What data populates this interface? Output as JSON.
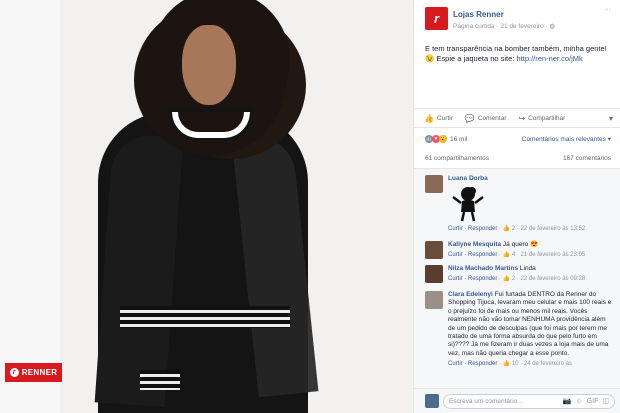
{
  "photo": {
    "brand_badge": "RENNER",
    "brand_mark": "r"
  },
  "post": {
    "page_name": "Lojas Renner",
    "page_avatar_letter": "r",
    "meta_source": "Página curtida",
    "meta_date": "21 de fevereiro",
    "meta_globe": "◍",
    "more_icon": "···",
    "text_line": "E tem transparência na bomber também, minha gente! 😉 Espie a jaqueta no site: ",
    "link": "http://ren-ner.co/jMk"
  },
  "actions": {
    "like": "Curtir",
    "comment": "Comentar",
    "share": "Compartilhar",
    "like_icon": "👍",
    "comment_icon": "💬",
    "share_icon": "↪",
    "share_menu_icon": "▾"
  },
  "reactions": {
    "count": "16 mil",
    "sort_label": "Comentários mais relevantes ▾",
    "like": "👍",
    "love": "♥",
    "wow": "😮"
  },
  "stats": {
    "shares": "61 compartilhamentos",
    "comments": "167 comentários"
  },
  "comments": [
    {
      "name": "Luana Dorba",
      "text": "",
      "reply_label": "Curtir · Responder",
      "likes": "2",
      "date": "22 de fevereiro às 13:52"
    },
    {
      "name": "Kallyne Mesquita",
      "text": "Já quero 😍",
      "reply_label": "Curtir · Responder",
      "likes": "4",
      "date": "21 de fevereiro às 23:05"
    },
    {
      "name": "Nilza Machado Martins",
      "text": "Linda",
      "reply_label": "Curtir · Responder",
      "likes": "2",
      "date": "22 de fevereiro às 09:28"
    },
    {
      "name": "Clara Edelenyi",
      "text": "Fui furtada DENTRO da Renner do Shopping Tijuca, levaram meu celular e mais 100 reais e o prejuízo foi de mais ou menos mil reais. Vocês realmente não vão tomar NENHUMA providência além de um pedido de desculpas (que foi mais por terem me tratado de uma forma absurda do que pelo furto em si)???? Já me fizeram ir duas vezes a loja mais de uma vez, mas não queria chegar a esse ponto.",
      "reply_label": "Curtir · Responder",
      "likes": "10",
      "date": "24 de fevereiro às"
    }
  ],
  "composer": {
    "placeholder": "Escreva um comentário...",
    "camera_icon": "📷",
    "emoji_icon": "☺",
    "gif_icon": "GIF",
    "sticker_icon": "◫"
  }
}
